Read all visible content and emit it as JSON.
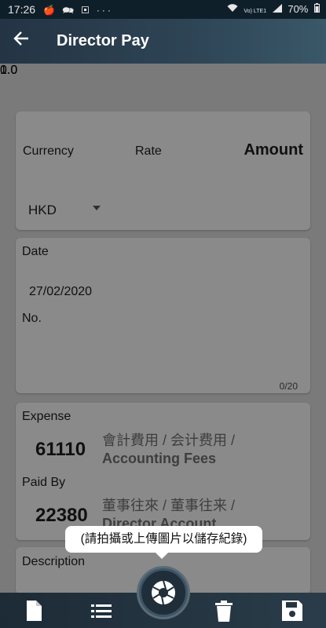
{
  "status_bar": {
    "time": "17:26",
    "left_icons": "🍎 🗪 ▣ ···",
    "signal": "Vo) LTE1",
    "battery": "70%"
  },
  "app_bar": {
    "title": "Director Pay",
    "back_icon": "arrow-left-icon"
  },
  "amount_card": {
    "currency_label": "Currency",
    "rate_label": "Rate",
    "amount_label": "Amount",
    "currency_value": "HKD",
    "rate_value": "1.0",
    "amount_value": "0.0"
  },
  "date_card": {
    "date_label": "Date",
    "date_value": "27/02/2020",
    "no_label": "No.",
    "counter": "0/20"
  },
  "account_card": {
    "expense_label": "Expense",
    "expense_code": "61110",
    "expense_desc_zh": "會計費用 / 会计费用 /",
    "expense_desc_en": "Accounting Fees",
    "paid_by_label": "Paid By",
    "paid_by_code": "22380",
    "paid_by_desc_zh": "董事往來 / 董事往来 /",
    "paid_by_desc_en": "Director Account"
  },
  "description_card": {
    "label": "Description"
  },
  "tooltip": {
    "text": "(請拍攝或上傳圖片以儲存紀錄)"
  },
  "bottom_bar": {
    "icons": [
      "document-icon",
      "list-icon",
      "camera-shutter-icon",
      "trash-icon",
      "save-icon"
    ]
  },
  "colors": {
    "app_bar": "#2e4556",
    "background_dimmed": "#7a7a7a",
    "card_dimmed": "#8a8a8a",
    "tooltip": "#ffffff"
  }
}
